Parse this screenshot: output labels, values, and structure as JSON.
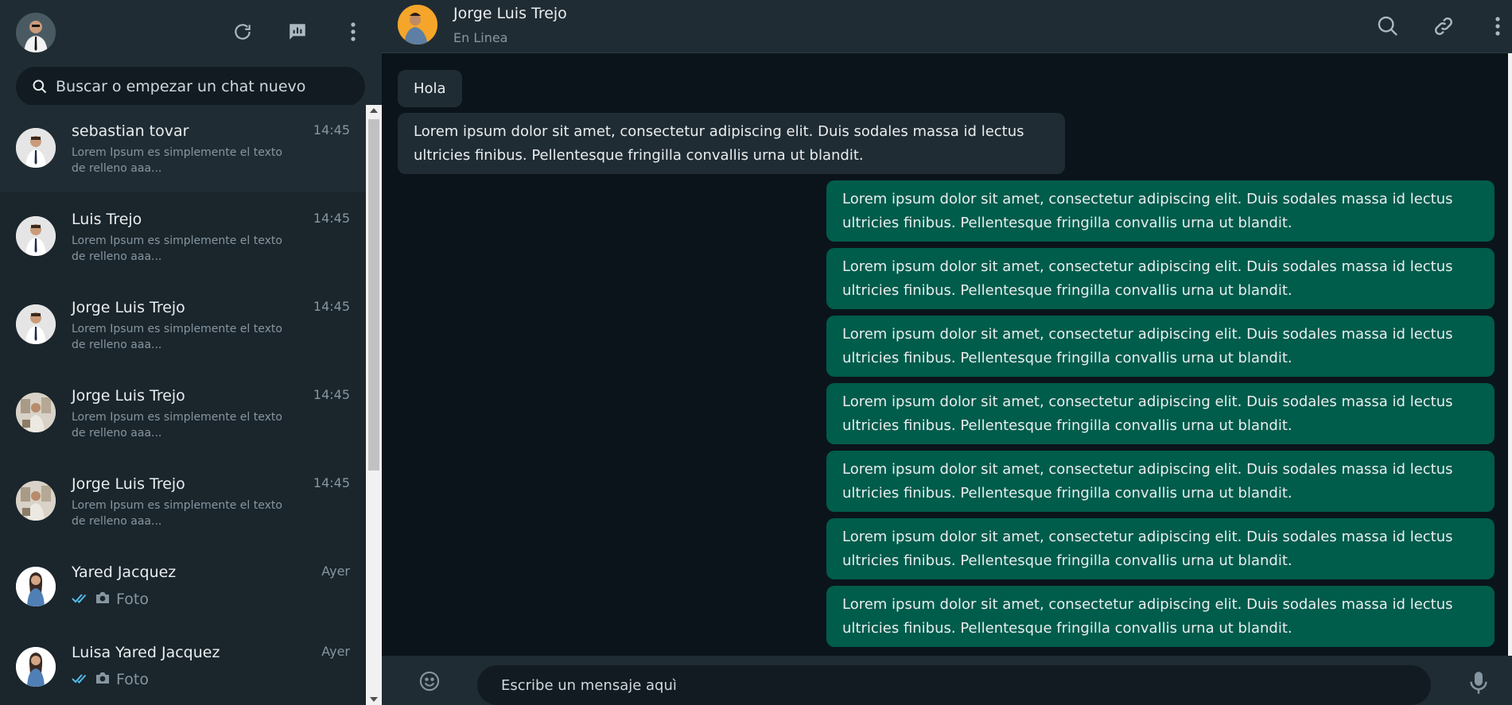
{
  "sidebar": {
    "search_placeholder": "Buscar o empezar un chat nuevo",
    "chats": [
      {
        "name": "sebastian tovar",
        "time": "14:45",
        "preview": "Lorem Ipsum es simplemente el texto de relleno aaa..."
      },
      {
        "name": "Luis Trejo",
        "time": "14:45",
        "preview": "Lorem Ipsum es simplemente el texto de relleno aaa..."
      },
      {
        "name": "Jorge Luis Trejo",
        "time": "14:45",
        "preview": "Lorem Ipsum es simplemente el texto de relleno aaa..."
      },
      {
        "name": "Jorge Luis Trejo",
        "time": "14:45",
        "preview": "Lorem Ipsum es simplemente el texto de relleno aaa..."
      },
      {
        "name": "Jorge Luis Trejo",
        "time": "14:45",
        "preview": "Lorem Ipsum es simplemente el texto de relleno aaa..."
      },
      {
        "name": "Yared Jacquez",
        "time": "Ayer",
        "preview": "Foto"
      },
      {
        "name": "Luisa Yared Jacquez",
        "time": "Ayer",
        "preview": "Foto"
      }
    ]
  },
  "chat": {
    "contact_name": "Jorge Luis Trejo",
    "contact_status": "En Linea",
    "messages": [
      {
        "direction": "in",
        "text": "Hola"
      },
      {
        "direction": "in",
        "text": "Lorem ipsum dolor sit amet, consectetur adipiscing elit. Duis sodales massa id lectus ultricies finibus. Pellentesque fringilla convallis urna ut blandit."
      },
      {
        "direction": "out",
        "text": "Lorem ipsum dolor sit amet, consectetur adipiscing elit. Duis sodales massa id lectus ultricies finibus. Pellentesque fringilla convallis urna ut blandit."
      },
      {
        "direction": "out",
        "text": "Lorem ipsum dolor sit amet, consectetur adipiscing elit. Duis sodales massa id lectus ultricies finibus. Pellentesque fringilla convallis urna ut blandit."
      },
      {
        "direction": "out",
        "text": "Lorem ipsum dolor sit amet, consectetur adipiscing elit. Duis sodales massa id lectus ultricies finibus. Pellentesque fringilla convallis urna ut blandit."
      },
      {
        "direction": "out",
        "text": "Lorem ipsum dolor sit amet, consectetur adipiscing elit. Duis sodales massa id lectus ultricies finibus. Pellentesque fringilla convallis urna ut blandit."
      },
      {
        "direction": "out",
        "text": "Lorem ipsum dolor sit amet, consectetur adipiscing elit. Duis sodales massa id lectus ultricies finibus. Pellentesque fringilla convallis urna ut blandit."
      },
      {
        "direction": "out",
        "text": "Lorem ipsum dolor sit amet, consectetur adipiscing elit. Duis sodales massa id lectus ultricies finibus. Pellentesque fringilla convallis urna ut blandit."
      },
      {
        "direction": "out",
        "text": "Lorem ipsum dolor sit amet, consectetur adipiscing elit. Duis sodales massa id lectus ultricies finibus. Pellentesque fringilla convallis urna ut blandit."
      }
    ],
    "input_placeholder": "Escribe un mensaje aquì"
  },
  "icons": {
    "header": [
      "refresh-icon",
      "status-icon",
      "menu-icon"
    ],
    "chat_header": [
      "search-icon",
      "attach-link-icon",
      "menu-icon"
    ],
    "composer": [
      "emoji-icon",
      "microphone-icon"
    ],
    "read_receipt": "double-check-icon",
    "photo": "camera-icon"
  },
  "colors": {
    "header_bg": "#202c33",
    "app_bg": "#0b141a",
    "incoming_bubble": "#202c33",
    "outgoing_bubble": "#005c4b",
    "read_check": "#53bdeb",
    "secondary_text": "#8696a0"
  }
}
